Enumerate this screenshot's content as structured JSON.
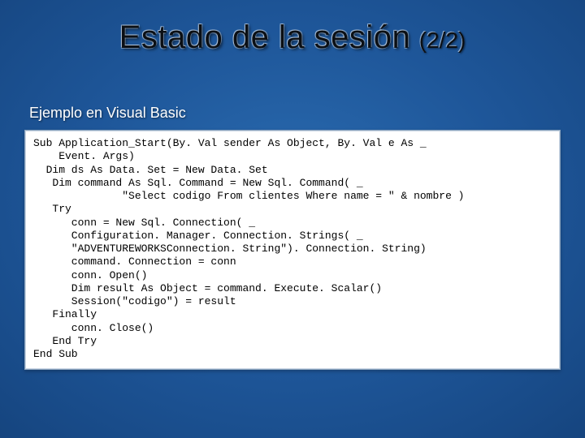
{
  "title": "Estado de la sesión",
  "pager": "(2/2)",
  "subtitle": "Ejemplo en Visual Basic",
  "code": "Sub Application_Start(By. Val sender As Object, By. Val e As _\n    Event. Args)\n  Dim ds As Data. Set = New Data. Set\n   Dim command As Sql. Command = New Sql. Command( _\n              \"Select codigo From clientes Where name = \" & nombre )\n   Try\n      conn = New Sql. Connection( _\n      Configuration. Manager. Connection. Strings( _\n      \"ADVENTUREWORKSConnection. String\"). Connection. String)\n      command. Connection = conn\n      conn. Open()\n      Dim result As Object = command. Execute. Scalar()\n      Session(\"codigo\") = result\n   Finally\n      conn. Close()\n   End Try\nEnd Sub"
}
